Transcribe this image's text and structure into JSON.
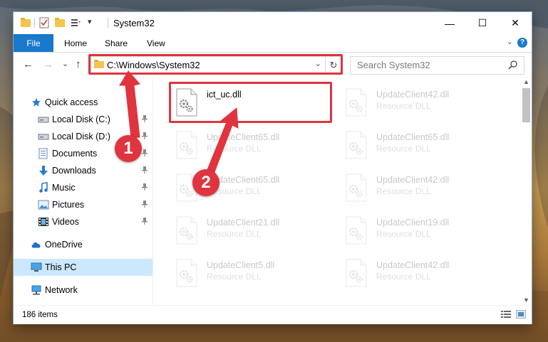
{
  "window": {
    "title": "System32",
    "controls": {
      "minimize": "—",
      "maximize": "☐",
      "close": "✕"
    }
  },
  "ribbon": {
    "tabs": [
      "File",
      "Home",
      "Share",
      "View"
    ],
    "help_label": "?",
    "expand_label": "⌄"
  },
  "navigation": {
    "back": "←",
    "forward": "→",
    "recent": "⌄",
    "up": "↑",
    "address": "C:\\Windows\\System32",
    "address_dropdown": "⌄",
    "refresh": "↻",
    "search_placeholder": "Search System32"
  },
  "sidebar": {
    "items": [
      {
        "label": "Quick access",
        "icon": "star-icon",
        "pinned": false
      },
      {
        "label": "Local Disk (C:)",
        "icon": "drive-icon",
        "pinned": true
      },
      {
        "label": "Local Disk (D:)",
        "icon": "drive-icon",
        "pinned": true
      },
      {
        "label": "Documents",
        "icon": "documents-icon",
        "pinned": true
      },
      {
        "label": "Downloads",
        "icon": "download-icon",
        "pinned": true
      },
      {
        "label": "Music",
        "icon": "music-icon",
        "pinned": true
      },
      {
        "label": "Pictures",
        "icon": "pictures-icon",
        "pinned": true
      },
      {
        "label": "Videos",
        "icon": "videos-icon",
        "pinned": true
      },
      {
        "label": "OneDrive",
        "icon": "cloud-icon",
        "pinned": false
      },
      {
        "label": "This PC",
        "icon": "computer-icon",
        "pinned": false,
        "selected": true
      },
      {
        "label": "Network",
        "icon": "network-icon",
        "pinned": false
      }
    ],
    "pin_glyph": "📌"
  },
  "files": [
    {
      "name": "ict_uc.dll",
      "type": "",
      "highlighted": true
    },
    {
      "name": "UpdateClient42.dll",
      "type": "Resource DLL"
    },
    {
      "name": "UpdateClient65.dll",
      "type": "Resource DLL"
    },
    {
      "name": "UpdateClient65.dll",
      "type": "Resource DLL"
    },
    {
      "name": "UpdateClient65.dll",
      "type": "Resource DLL"
    },
    {
      "name": "UpdateClient42.dll",
      "type": "Resource DLL"
    },
    {
      "name": "UpdateClient21.dll",
      "type": "Resource DLL"
    },
    {
      "name": "UpdateClient19.dll",
      "type": "Resource DLL"
    },
    {
      "name": "UpdateClient5.dll",
      "type": "Resource DLL"
    },
    {
      "name": "UpdateClient42.dll",
      "type": "Resource DLL"
    }
  ],
  "status": {
    "item_count": "186 items"
  },
  "annotations": {
    "step1": "1",
    "step2": "2",
    "color": "#e0343f"
  }
}
